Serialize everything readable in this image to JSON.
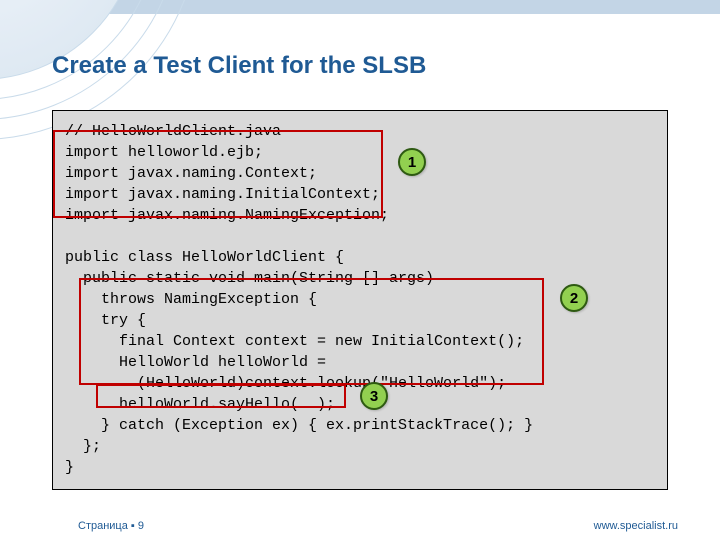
{
  "title": "Create a Test Client for the SLSB",
  "code": {
    "lines": [
      "// HelloWorldClient.java",
      "import helloworld.ejb;",
      "import javax.naming.Context;",
      "import javax.naming.InitialContext;",
      "import javax.naming.NamingException;",
      "",
      "public class HelloWorldClient {",
      "  public static void main(String [] args)",
      "    throws NamingException {",
      "    try {",
      "      final Context context = new InitialContext();",
      "      HelloWorld helloWorld =",
      "        (HelloWorld)context.lookup(\"HelloWorld\");",
      "      helloWorld.sayHello(  );",
      "    } catch (Exception ex) { ex.printStackTrace(); }",
      "  };",
      "}"
    ]
  },
  "callouts": {
    "c1": "1",
    "c2": "2",
    "c3": "3"
  },
  "footer": {
    "page_label": "Страница",
    "bullet": "▪",
    "page_number": "9",
    "site": "www.specialist.ru"
  }
}
